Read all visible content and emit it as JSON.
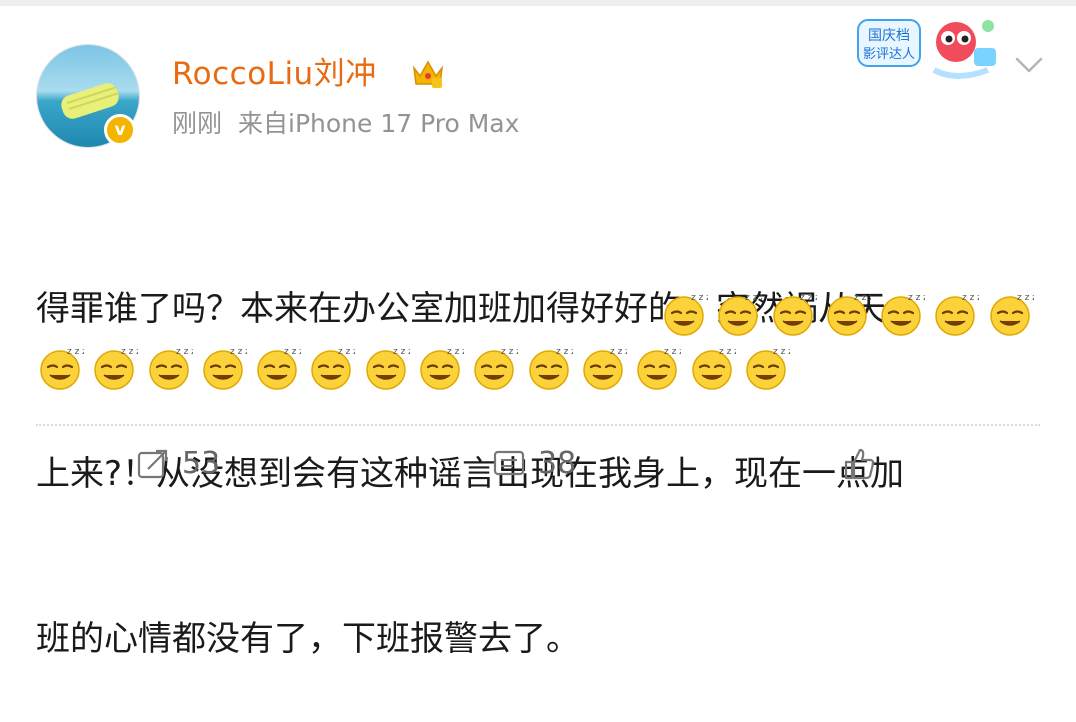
{
  "post": {
    "author": {
      "name": "RoccoLiu刘冲",
      "avatar": "avatar-inflatable-float-on-water",
      "verified_icon": "v-badge-icon",
      "verified_label": "v",
      "member_icon": "crown-icon"
    },
    "time": "刚刚",
    "source": "来自iPhone 17 Pro Max",
    "campaign_badge": {
      "text_line1": "国庆档",
      "text_line2": "影评达人",
      "icon": "campaign-mascot-icon"
    },
    "more_icon": "chevron-down-icon",
    "content_lines": [
      "得罪谁了吗？本来在办公室加班加得好好的，突然祸从天",
      "上来?！从没想到会有这种谣言出现在我身上，现在一点加",
      "班的心情都没有了，下班报警去了。"
    ],
    "emoji_name": "sleepy-face-emoji",
    "emoji_count_line3": 7,
    "emoji_count_line4": 14,
    "actions": {
      "repost_count": "53",
      "comment_count": "38",
      "like_count": ""
    }
  }
}
